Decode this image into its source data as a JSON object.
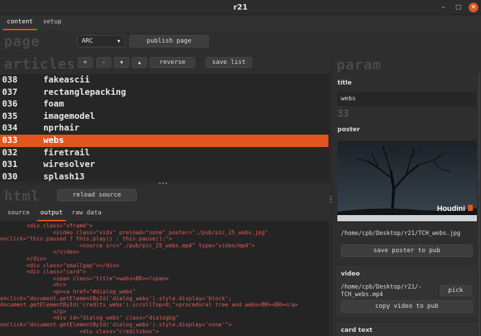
{
  "window": {
    "title": "r21"
  },
  "top_tabs": [
    {
      "label": "content"
    },
    {
      "label": "setup"
    }
  ],
  "page": {
    "section_title": "page",
    "combo_value": "ARC",
    "publish_label": "publish page"
  },
  "articles": {
    "section_title": "articles",
    "buttons": {
      "add": "+",
      "remove": "-",
      "down": "▼",
      "up": "▲",
      "reverse": "reverse",
      "save": "save list"
    },
    "items": [
      {
        "num": "038",
        "name": "fakeascii"
      },
      {
        "num": "037",
        "name": "rectanglepacking"
      },
      {
        "num": "036",
        "name": "foam"
      },
      {
        "num": "035",
        "name": "imagemodel"
      },
      {
        "num": "034",
        "name": "nprhair"
      },
      {
        "num": "033",
        "name": "webs"
      },
      {
        "num": "032",
        "name": "firetrail"
      },
      {
        "num": "031",
        "name": "wiresolver"
      },
      {
        "num": "030",
        "name": "splash13"
      }
    ],
    "selected_index": 5
  },
  "html": {
    "section_title": "html",
    "reload_label": "reload source",
    "tabs": [
      {
        "label": "source"
      },
      {
        "label": "output"
      },
      {
        "label": "raw data"
      }
    ],
    "active_tab": 1,
    "code_lines": [
      "        <div class=\"vframe\">",
      "                <video class=\"vids\" preload=\"none\" poster=\"./pub/pic_25_webs.jpg\"",
      "onclick=\"this.paused ? this.play() : this.pause();\">",
      "                        <source src=\"./pub/pic_25_webs.mp4\" type=\"video/mp4\">",
      "                </video>",
      "        </div>",
      "        <div class=\"smallgap\"></div>",
      "        <div class=\"card\">",
      "                <span class=\"title\">webs<BR></span>",
      "                <hr>",
      "                <p><a href=\"#dialog_webs\"",
      "onclick=\"document.getElementById('dialog_webs').style.display='block';",
      "document.getElementById('credits_webs').scrollTop=0;\">procedural tree and webs<BR><BR></a>",
      "                </p>",
      "                <div id=\"dialog_webs\" class=\"dialogbg\"",
      "onclick=\"document.getElementById('dialog_webs').style.display='none'\">",
      "                        <div class=\"creditsbox\">"
    ]
  },
  "param": {
    "section_title": "param",
    "title_label": "title",
    "title_value": "webs",
    "number": "33",
    "poster_label": "poster",
    "poster_caption": "Houdini",
    "poster_path": "/home/cpb/Desktop/r21/TCH_webs.jpg",
    "save_poster_label": "save poster to pub",
    "video_label": "video",
    "video_path_line1": "/home/cpb/Desktop/r21/-",
    "video_path_line2": "TCH_webs.mp4",
    "pick_label": "pick",
    "copy_video_label": "copy video to pub",
    "card_text_label": "card text"
  },
  "colors": {
    "accent": "#e0561e",
    "code_text": "#e75c5c",
    "background": "#2b2b2b"
  },
  "icons": {
    "minimize": "minimize-icon",
    "maximize": "maximize-icon",
    "close": "close-icon",
    "dropdown": "triangle-down-icon"
  }
}
